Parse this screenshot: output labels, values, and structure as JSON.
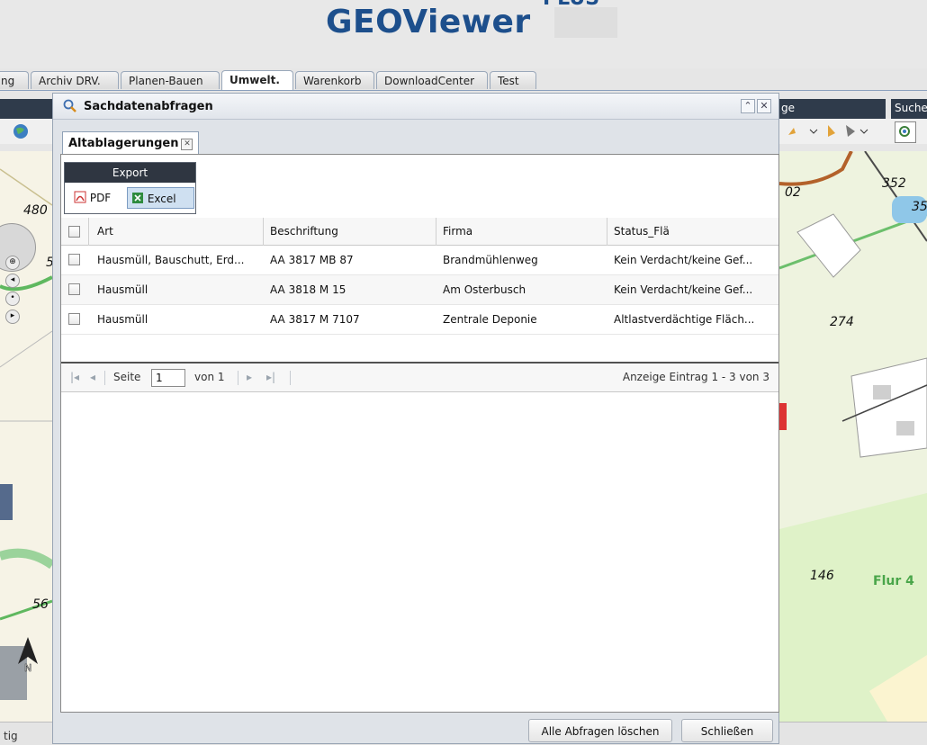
{
  "app": {
    "title": "GEOViewer",
    "title_suffix": "PLUS"
  },
  "tabs": [
    {
      "label": "ng"
    },
    {
      "label": "Archiv DRV."
    },
    {
      "label": "Planen-Bauen"
    },
    {
      "label": "Umwelt.",
      "active": true
    },
    {
      "label": "Warenkorb"
    },
    {
      "label": "DownloadCenter"
    },
    {
      "label": "Test"
    }
  ],
  "toolbar_right": {
    "label_ge": "ge",
    "label_suche": "Suche"
  },
  "map_labels": {
    "l480": "480",
    "l56": "56",
    "l5": "5",
    "r352": "352",
    "r35": "35",
    "r02": "02",
    "r274": "274",
    "r146": "146",
    "flur": "Flur 4"
  },
  "dialog": {
    "title": "Sachdatenabfragen",
    "tab_label": "Altablagerungen",
    "export": {
      "header": "Export",
      "pdf_label": "PDF",
      "excel_label": "Excel"
    },
    "columns": [
      "Art",
      "Beschriftung",
      "Firma",
      "Status_Flä"
    ],
    "rows": [
      {
        "art": "Hausmüll, Bauschutt, Erd...",
        "beschriftung": "AA 3817 MB 87",
        "firma": "Brandmühlenweg",
        "status": "Kein Verdacht/keine Gef..."
      },
      {
        "art": "Hausmüll",
        "beschriftung": "AA 3818 M 15",
        "firma": "Am Osterbusch",
        "status": "Kein Verdacht/keine Gef..."
      },
      {
        "art": "Hausmüll",
        "beschriftung": "AA 3817 M 7107",
        "firma": "Zentrale Deponie",
        "status": "Altlastverdächtige Fläch..."
      }
    ],
    "pager": {
      "page_label": "Seite",
      "page_value": "1",
      "of_label": "von 1",
      "display_text": "Anzeige Eintrag 1 - 3 von 3"
    },
    "buttons": {
      "clear_all": "Alle Abfragen löschen",
      "close": "Schließen"
    }
  },
  "status": {
    "text": "tig"
  },
  "colors": {
    "brand": "#1d4f8c",
    "toolbar_dark": "#2f3b4b",
    "export_header": "#2f3641",
    "excel_selected": "#cfe0f1"
  }
}
